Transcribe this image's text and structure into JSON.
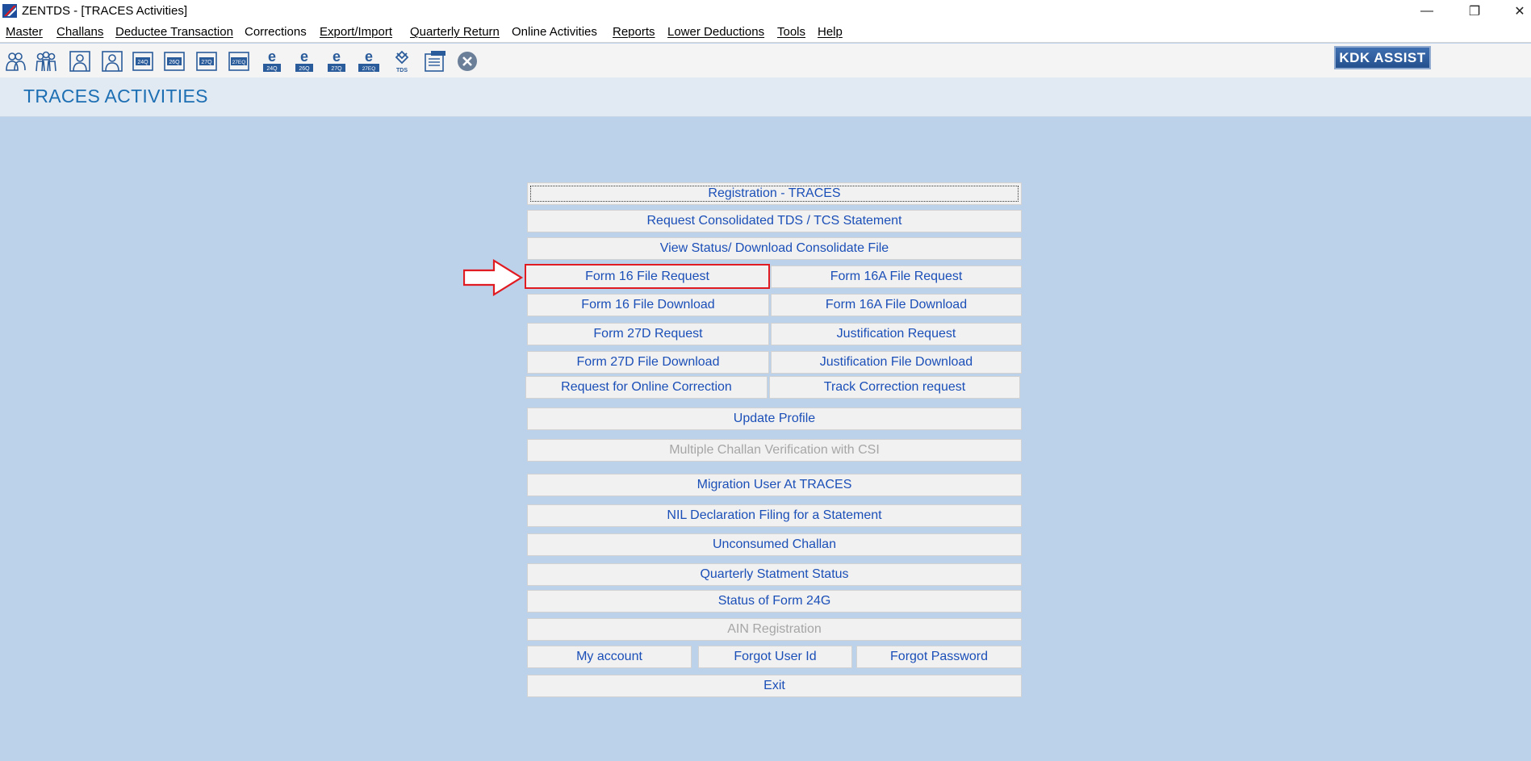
{
  "window": {
    "title": "ZENTDS - [TRACES Activities]",
    "minimize": "—",
    "restore": "❐",
    "close": "✕"
  },
  "menu": [
    {
      "label": "Master",
      "underline": true
    },
    {
      "label": "Challans",
      "underline": true
    },
    {
      "label": "Deductee Transaction",
      "underline": true
    },
    {
      "label": "Corrections",
      "underline": false
    },
    {
      "label": "Export/Import",
      "underline": true
    },
    {
      "label": "Quarterly Return",
      "underline": true
    },
    {
      "label": "Online Activities",
      "underline": false
    },
    {
      "label": "Reports",
      "underline": true
    },
    {
      "label": "Lower Deductions",
      "underline": true
    },
    {
      "label": "Tools",
      "underline": true
    },
    {
      "label": "Help",
      "underline": true
    }
  ],
  "toolbar": {
    "icons": [
      "deductor-icon",
      "deductee-group-icon",
      "deductee-icon",
      "employee-icon",
      "form-24q-icon",
      "form-26q-icon",
      "form-27q-icon",
      "form-27eq-icon",
      "e-24q-icon",
      "e-26q-icon",
      "e-27q-icon",
      "e-27eq-icon",
      "tds-icon",
      "notes-icon",
      "close-circle-icon"
    ],
    "icon_labels": {
      "f24q": "24Q",
      "f26q": "26Q",
      "f27q": "27Q",
      "f27eq": "27EQ",
      "e24q": "24Q",
      "e26q": "26Q",
      "e27q": "27Q",
      "e27eq": "27EQ",
      "tds": "TDS"
    },
    "kdk_assist": "KDK ASSIST"
  },
  "page": {
    "title": "TRACES ACTIVITIES"
  },
  "buttons": {
    "registration": "Registration - TRACES",
    "request_consolidated": "Request Consolidated TDS / TCS Statement",
    "view_status": "View Status/ Download Consolidate File",
    "form16_request": "Form 16 File Request",
    "form16a_request": "Form 16A File Request",
    "form16_download": "Form 16 File Download",
    "form16a_download": "Form 16A File Download",
    "form27d_request": "Form 27D Request",
    "justification_request": "Justification Request",
    "form27d_download": "Form 27D File Download",
    "justification_download": "Justification File Download",
    "online_correction": "Request for Online Correction",
    "track_correction": "Track Correction request",
    "update_profile": "Update Profile",
    "multiple_challan": "Multiple Challan Verification with CSI",
    "migration_user": "Migration User At TRACES",
    "nil_declaration": "NIL Declaration Filing for a Statement",
    "unconsumed_challan": "Unconsumed Challan",
    "quarterly_status": "Quarterly Statment Status",
    "status_24g": "Status of Form 24G",
    "ain_registration": "AIN Registration",
    "my_account": "My account",
    "forgot_user_id": "Forgot User Id",
    "forgot_password": "Forgot Password",
    "exit": "Exit"
  },
  "colors": {
    "background": "#bcd1ea",
    "title_blue": "#1d6fb3",
    "link_blue": "#1b4fb8",
    "highlight_red": "#e11b22",
    "disabled": "#a6a6a6"
  }
}
